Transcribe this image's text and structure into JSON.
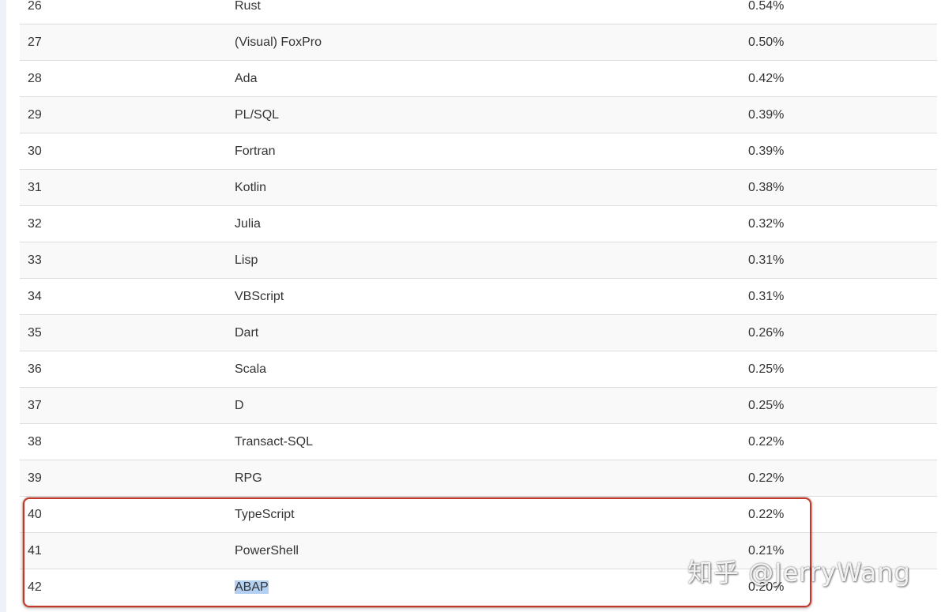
{
  "table": {
    "rows": [
      {
        "rank": "26",
        "language": "Rust",
        "rating": "0.54%"
      },
      {
        "rank": "27",
        "language": "(Visual) FoxPro",
        "rating": "0.50%"
      },
      {
        "rank": "28",
        "language": "Ada",
        "rating": "0.42%"
      },
      {
        "rank": "29",
        "language": "PL/SQL",
        "rating": "0.39%"
      },
      {
        "rank": "30",
        "language": "Fortran",
        "rating": "0.39%"
      },
      {
        "rank": "31",
        "language": "Kotlin",
        "rating": "0.38%"
      },
      {
        "rank": "32",
        "language": "Julia",
        "rating": "0.32%"
      },
      {
        "rank": "33",
        "language": "Lisp",
        "rating": "0.31%"
      },
      {
        "rank": "34",
        "language": "VBScript",
        "rating": "0.31%"
      },
      {
        "rank": "35",
        "language": "Dart",
        "rating": "0.26%"
      },
      {
        "rank": "36",
        "language": "Scala",
        "rating": "0.25%"
      },
      {
        "rank": "37",
        "language": "D",
        "rating": "0.25%"
      },
      {
        "rank": "38",
        "language": "Transact-SQL",
        "rating": "0.22%"
      },
      {
        "rank": "39",
        "language": "RPG",
        "rating": "0.22%"
      },
      {
        "rank": "40",
        "language": "TypeScript",
        "rating": "0.22%"
      },
      {
        "rank": "41",
        "language": "PowerShell",
        "rating": "0.21%"
      },
      {
        "rank": "42",
        "language": "ABAP",
        "rating": "0.20%"
      }
    ],
    "selected_language": "ABAP",
    "highlighted_ranks": [
      "40",
      "41",
      "42"
    ]
  },
  "watermark": {
    "text": "知乎 @JerryWang"
  },
  "colors": {
    "highlight_border": "#c0392b",
    "selection": "#b3d0f2",
    "row_stripe": "#f9f9f9",
    "text": "#333333"
  }
}
